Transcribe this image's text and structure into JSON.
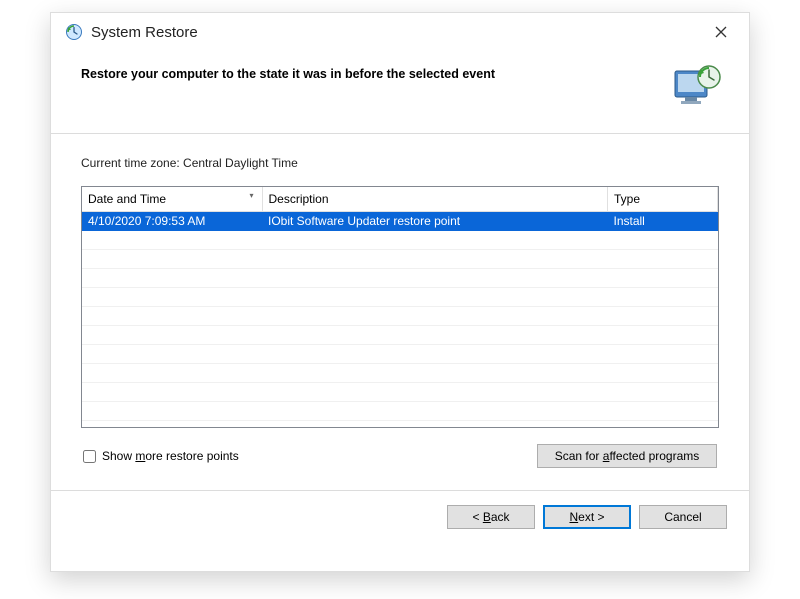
{
  "window": {
    "title": "System Restore"
  },
  "header": {
    "heading": "Restore your computer to the state it was in before the selected event"
  },
  "body": {
    "timezone_label": "Current time zone: Central Daylight Time",
    "columns": {
      "date": "Date and Time",
      "desc": "Description",
      "type": "Type"
    },
    "rows": [
      {
        "date": "4/10/2020 7:09:53 AM",
        "desc": "IObit Software Updater restore point",
        "type": "Install",
        "selected": true
      }
    ],
    "checkbox_pre": "Show ",
    "checkbox_u": "m",
    "checkbox_post": "ore restore points",
    "scan_pre": "Scan for ",
    "scan_u": "a",
    "scan_post": "ffected programs"
  },
  "footer": {
    "back_lt": "< ",
    "back_u": "B",
    "back_post": "ack",
    "next_u": "N",
    "next_post": "ext >",
    "cancel": "Cancel"
  }
}
